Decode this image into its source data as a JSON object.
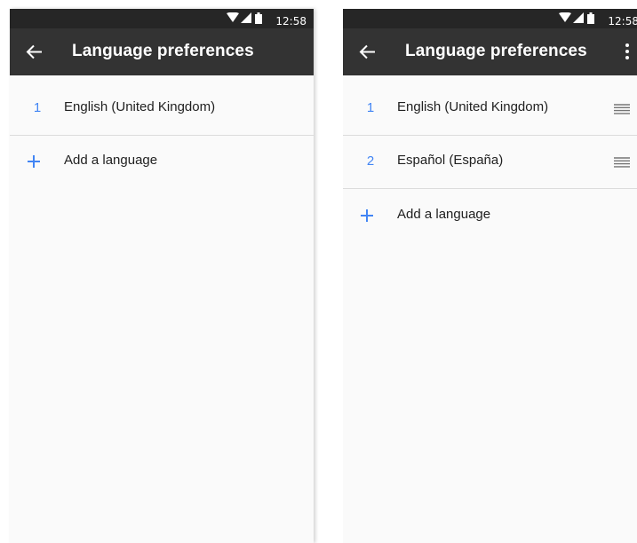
{
  "screens": [
    {
      "status_bar": {
        "time": "12:58"
      },
      "app_bar": {
        "title": "Language preferences"
      },
      "languages": [
        {
          "index": "1",
          "label": "English (United Kingdom)"
        }
      ],
      "add_language_label": "Add a language"
    },
    {
      "status_bar": {
        "time": "12:58"
      },
      "app_bar": {
        "title": "Language preferences"
      },
      "languages": [
        {
          "index": "1",
          "label": "English (United Kingdom)"
        },
        {
          "index": "2",
          "label": "Español (España)"
        }
      ],
      "add_language_label": "Add a language"
    }
  ],
  "icons": {
    "back": "arrow-left",
    "add": "plus",
    "reorder": "drag-handle",
    "menu": "more-vertical",
    "wifi": "wifi-signal",
    "cellular": "cellular-signal",
    "battery": "battery"
  },
  "colors": {
    "app_bar": "#333333",
    "status_bar": "#262626",
    "accent": "#4285f4",
    "background": "#fafafa",
    "text": "#212121"
  }
}
